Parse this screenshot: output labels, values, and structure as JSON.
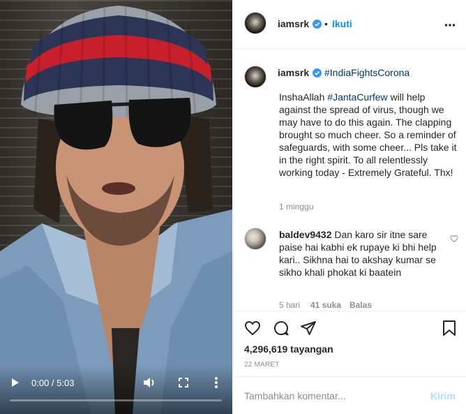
{
  "video": {
    "time_display": "0:00 / 5:03",
    "progress": 0
  },
  "header": {
    "username": "iamsrk",
    "separator": "•",
    "follow_label": "Ikuti"
  },
  "caption": {
    "username": "iamsrk",
    "hashtag_tag": "#IndiaFightsCorona",
    "text_before": "InshaAllah ",
    "text_hashtag": "#JantaCurfew",
    "text_after": " will help against the spread of virus, though we may have to do this again. The clapping brought so much cheer. So a reminder of safeguards, with some cheer... Pls take it in the right spirit. To all relentlessly working today - Extremely Grateful. Thx!",
    "time": "1 minggu"
  },
  "comment": {
    "username": "baldev9432",
    "text": "Dan karo sir itne sare paise hai kabhi ek rupaye ki bhi help kari.. Sikhna hai to akshay kumar se sikho khali phokat ki baatein",
    "time": "5 hari",
    "likes": "41 suka",
    "reply_label": "Balas"
  },
  "stats": {
    "views": "4,296,619 tayangan",
    "date": "22 MARET"
  },
  "composer": {
    "placeholder": "Tambahkan komentar...",
    "post_label": "Kirim"
  },
  "colors": {
    "link_blue": "#0095f6",
    "hashtag_blue": "#00376b",
    "disabled_blue": "#b2dffc",
    "muted_gray": "#8e8e8e"
  },
  "icons": [
    "play-icon",
    "volume-icon",
    "fullscreen-icon",
    "more-vertical-icon",
    "verified-badge-icon",
    "more-horizontal-icon",
    "heart-icon",
    "comment-icon",
    "share-icon",
    "bookmark-icon"
  ]
}
